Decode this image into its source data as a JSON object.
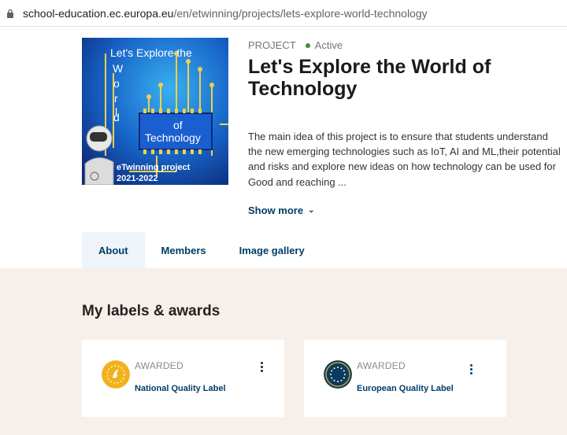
{
  "browser": {
    "url_host": "school-education.ec.europa.eu",
    "url_path": "/en/etwinning/projects/lets-explore-world-technology"
  },
  "project": {
    "image_text": {
      "line1": "Let's Explore the",
      "vertical_letters": [
        "W",
        "o",
        "r",
        "l",
        "d"
      ],
      "of": "of",
      "technology": "Technology",
      "etwinning": "eTwinning project",
      "years": "2021-2022"
    },
    "type_label": "PROJECT",
    "status": "Active",
    "title": "Let's Explore the World of Technology",
    "description": "The main idea of this project is to ensure that students understand the new emerging technologies such as IoT, AI and ML,their potential and risks and explore new ideas on how technology can be used for Good and reaching ...",
    "show_more": "Show more"
  },
  "tabs": [
    {
      "label": "About",
      "active": true
    },
    {
      "label": "Members",
      "active": false
    },
    {
      "label": "Image gallery",
      "active": false
    }
  ],
  "labels_section": {
    "title": "My labels & awards",
    "cards": [
      {
        "status": "AWARDED",
        "name": "National Quality Label",
        "icon": "national-quality-label-icon"
      },
      {
        "status": "AWARDED",
        "name": "European Quality Label",
        "icon": "european-quality-label-icon"
      }
    ]
  },
  "colors": {
    "link": "#003e66",
    "active_dot": "#3e8e2f",
    "section_bg": "#f7efea",
    "tab_active_bg": "#eef4f9"
  }
}
